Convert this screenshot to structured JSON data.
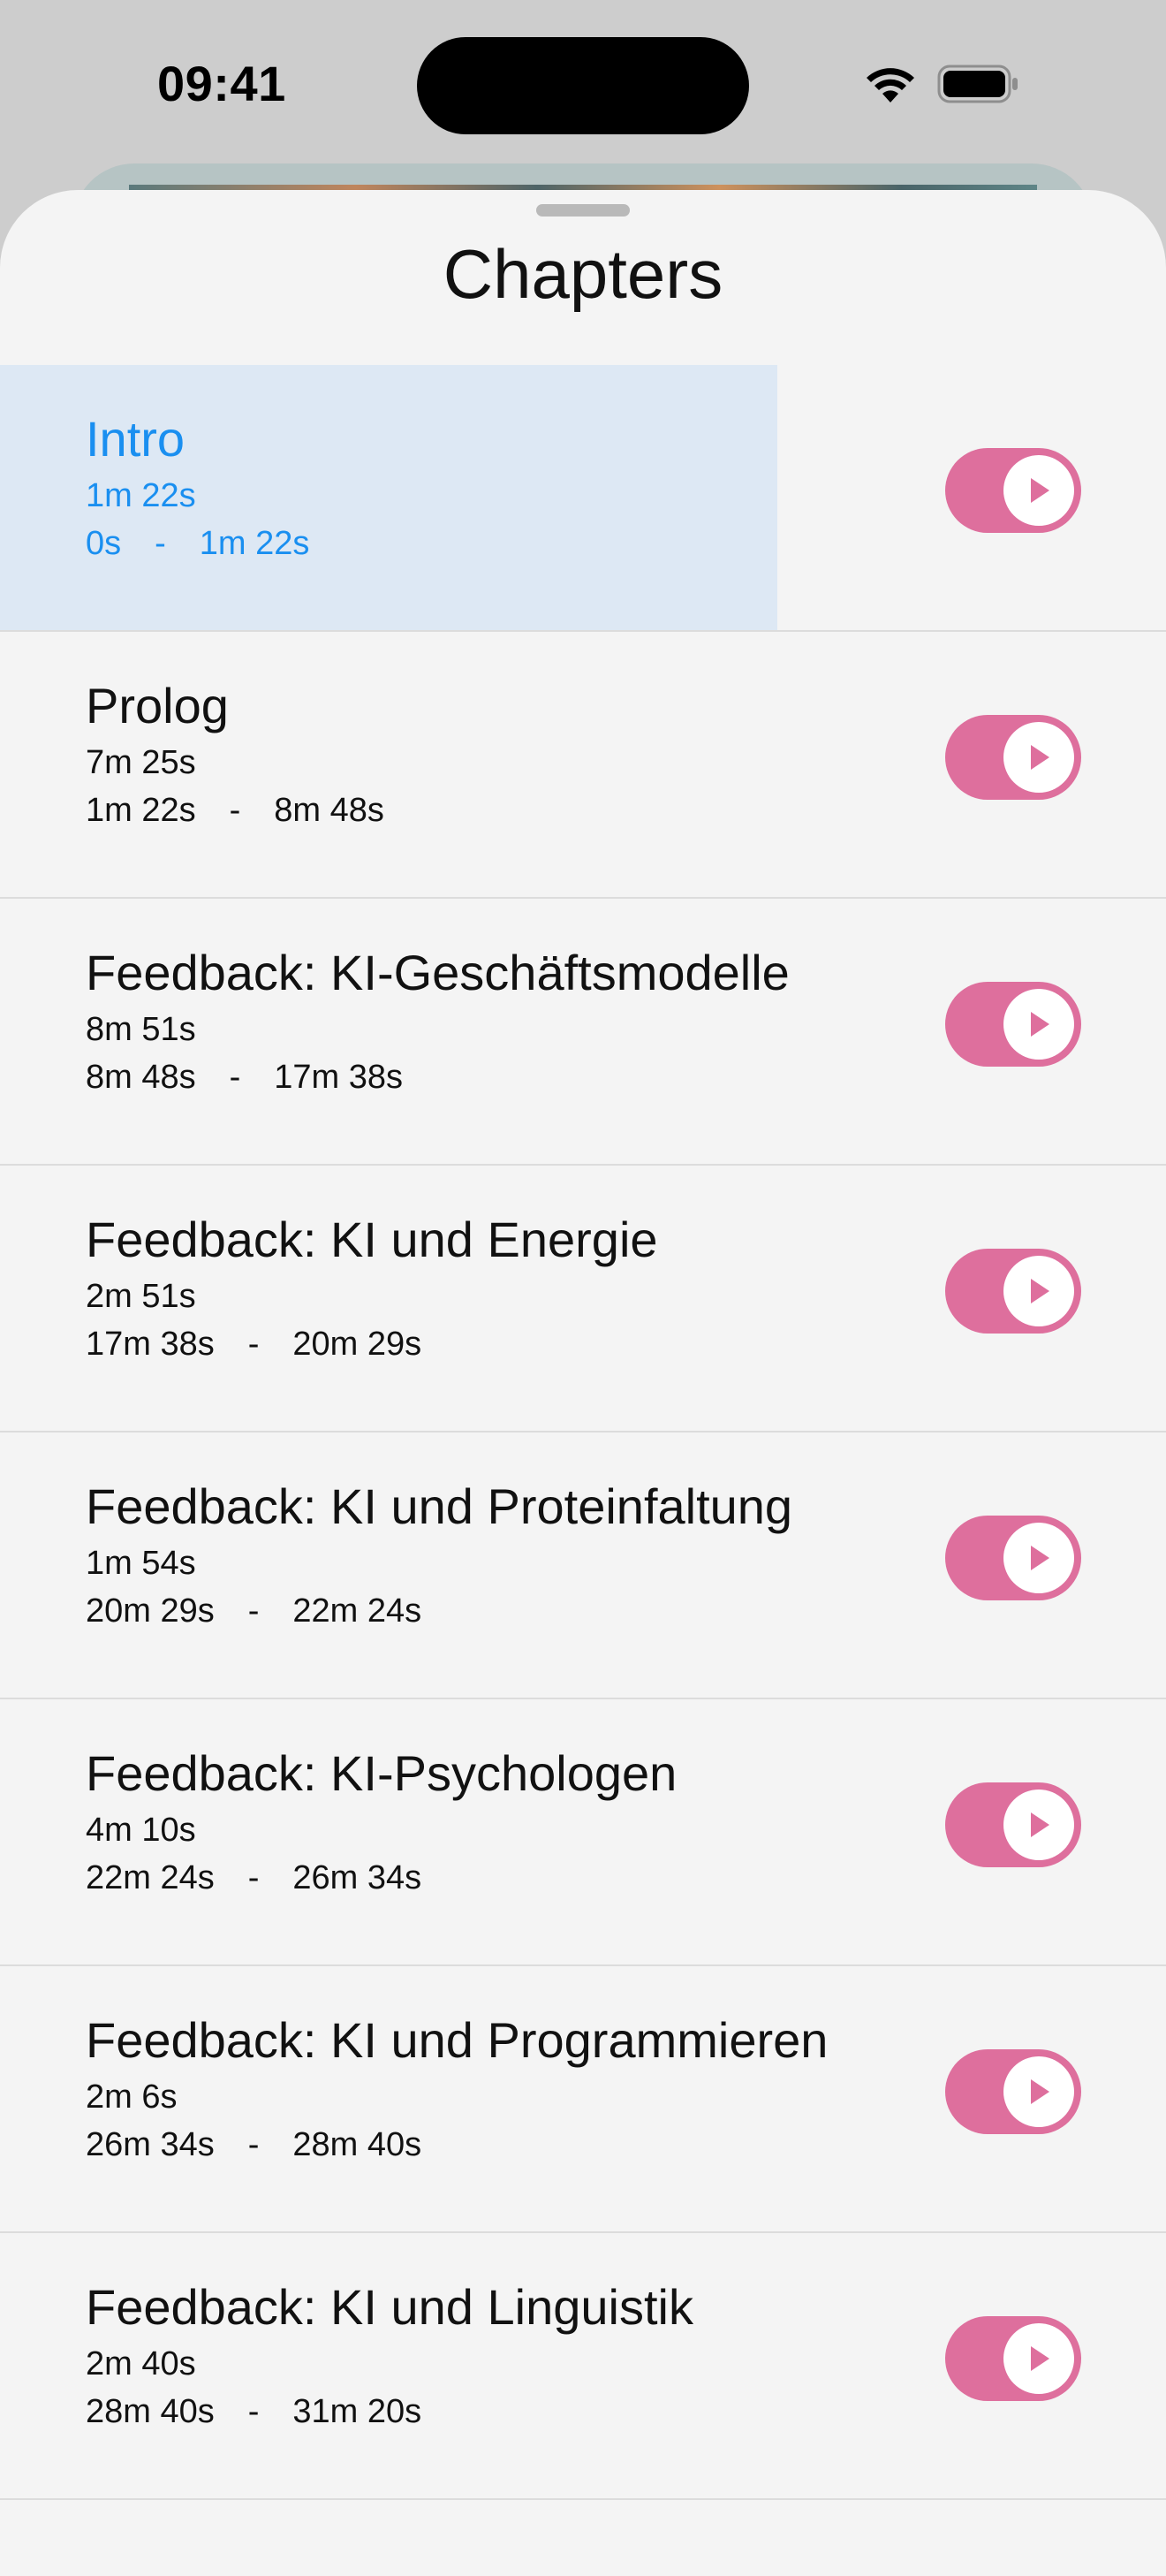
{
  "status_bar": {
    "time": "09:41",
    "icons": [
      "wifi-icon",
      "battery-icon"
    ]
  },
  "sheet": {
    "title": "Chapters"
  },
  "colors": {
    "accent": "#1a8ff0",
    "play_toggle": "#de6f9d",
    "active_row_bg": "#dde8f4"
  },
  "chapters": [
    {
      "title": "Intro",
      "duration": "1m 22s",
      "start": "0s",
      "separator": "-",
      "end": "1m 22s",
      "active": true
    },
    {
      "title": "Prolog",
      "duration": "7m 25s",
      "start": "1m 22s",
      "separator": "-",
      "end": "8m 48s",
      "active": false
    },
    {
      "title": "Feedback: KI-Geschäftsmodelle",
      "duration": "8m 51s",
      "start": "8m 48s",
      "separator": "-",
      "end": "17m 38s",
      "active": false
    },
    {
      "title": "Feedback: KI und Energie",
      "duration": "2m 51s",
      "start": "17m 38s",
      "separator": "-",
      "end": "20m 29s",
      "active": false
    },
    {
      "title": "Feedback: KI und Proteinfaltung",
      "duration": "1m 54s",
      "start": "20m 29s",
      "separator": "-",
      "end": "22m 24s",
      "active": false
    },
    {
      "title": "Feedback: KI-Psychologen",
      "duration": "4m 10s",
      "start": "22m 24s",
      "separator": "-",
      "end": "26m 34s",
      "active": false
    },
    {
      "title": "Feedback: KI und Programmieren",
      "duration": "2m 6s",
      "start": "26m 34s",
      "separator": "-",
      "end": "28m 40s",
      "active": false
    },
    {
      "title": "Feedback: KI und Linguistik",
      "duration": "2m 40s",
      "start": "28m 40s",
      "separator": "-",
      "end": "31m 20s",
      "active": false
    }
  ]
}
